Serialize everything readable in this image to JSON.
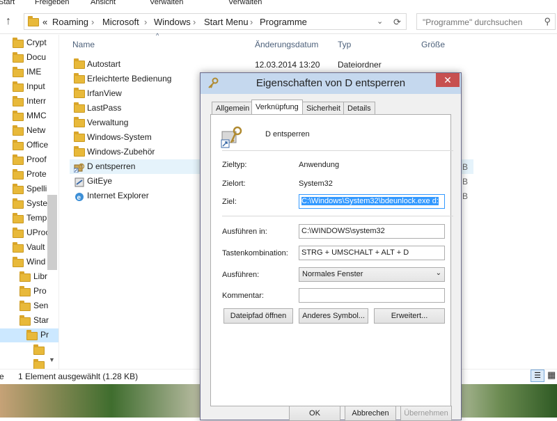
{
  "ribbon": {
    "items": [
      "Start",
      "Freigeben",
      "Ansicht",
      "Verwalten",
      "Verwalten"
    ]
  },
  "address": {
    "prefix": "«",
    "crumbs": [
      "Roaming",
      "Microsoft",
      "Windows",
      "Start Menu",
      "Programme"
    ]
  },
  "search": {
    "placeholder": "\"Programme\" durchsuchen"
  },
  "sidebar": {
    "items": [
      "Crypt",
      "Docu",
      "IME",
      "Input",
      "Interr",
      "MMC",
      "Netw",
      "Office",
      "Proof",
      "Prote",
      "Spelli",
      "Syster",
      "Temp",
      "UProc",
      "Vault",
      "Wind",
      "Libr",
      "Pro",
      "Sen",
      "Star",
      "Pr",
      "",
      ""
    ]
  },
  "columns": {
    "name": "Name",
    "date": "Änderungsdatum",
    "type": "Typ",
    "size": "Größe"
  },
  "files": [
    {
      "name": "Autostart",
      "date": "12.03.2014 13:20",
      "type": "Dateiordner",
      "size": ""
    },
    {
      "name": "Erleichterte Bedienung",
      "date": "",
      "type": "",
      "size": ""
    },
    {
      "name": "IrfanView",
      "date": "",
      "type": "",
      "size": ""
    },
    {
      "name": "LastPass",
      "date": "",
      "type": "",
      "size": ""
    },
    {
      "name": "Verwaltung",
      "date": "",
      "type": "",
      "size": ""
    },
    {
      "name": "Windows-System",
      "date": "",
      "type": "",
      "size": ""
    },
    {
      "name": "Windows-Zubehör",
      "date": "",
      "type": "",
      "size": ""
    },
    {
      "name": "D entsperren",
      "date": "",
      "type": "",
      "size": "B"
    },
    {
      "name": "GitEye",
      "date": "",
      "type": "",
      "size": "B"
    },
    {
      "name": "Internet Explorer",
      "date": "",
      "type": "",
      "size": "B"
    }
  ],
  "status": {
    "count": "e",
    "selection": "1 Element ausgewählt (1.28 KB)"
  },
  "dialog": {
    "title": "Eigenschaften von D entsperren",
    "tabs": [
      "Allgemein",
      "Verknüpfung",
      "Sicherheit",
      "Details"
    ],
    "shortcut_name": "D entsperren",
    "fields": {
      "zieltyp_label": "Zieltyp:",
      "zieltyp_value": "Anwendung",
      "zielort_label": "Zielort:",
      "zielort_value": "System32",
      "ziel_label": "Ziel:",
      "ziel_value": "C:\\Windows\\System32\\bdeunlock.exe d:",
      "ausfuehren_in_label": "Ausführen in:",
      "ausfuehren_in_value": "C:\\WINDOWS\\system32",
      "tasten_label": "Tastenkombination:",
      "tasten_value": "STRG + UMSCHALT + ALT + D",
      "ausfuehren_label": "Ausführen:",
      "ausfuehren_value": "Normales Fenster",
      "kommentar_label": "Kommentar:",
      "kommentar_value": ""
    },
    "buttons": {
      "open_path": "Dateipfad öffnen",
      "change_icon": "Anderes Symbol...",
      "advanced": "Erweitert...",
      "ok": "OK",
      "cancel": "Abbrechen",
      "apply": "Übernehmen"
    }
  }
}
